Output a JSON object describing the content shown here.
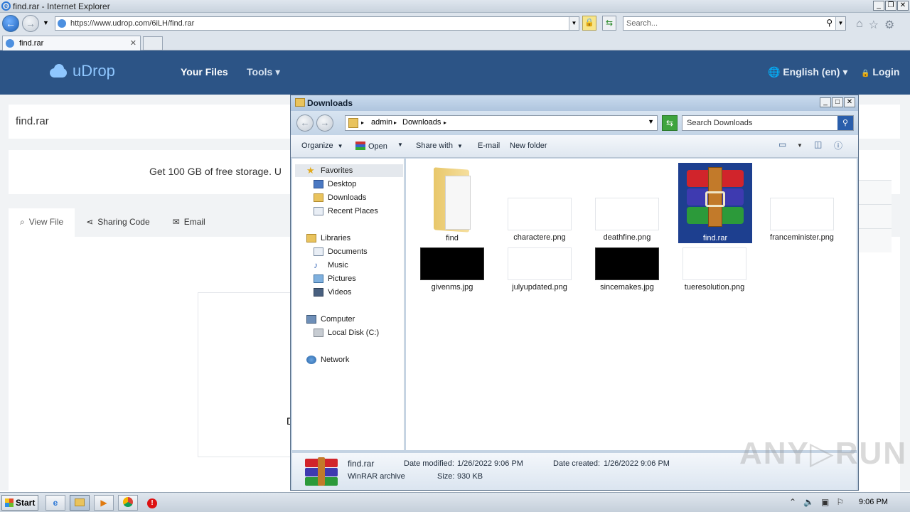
{
  "browser": {
    "window_title": "find.rar - Internet Explorer",
    "url": "https://www.udrop.com/6iLH/find.rar",
    "search_placeholder": "Search...",
    "tab_label": "find.rar",
    "tab_close": "✕"
  },
  "site": {
    "logo": "uDrop",
    "nav": {
      "your_files": "Your Files",
      "tools": "Tools ▾",
      "language": "English (en) ▾",
      "login": "Login"
    },
    "file_name": "find.rar",
    "promo": "Get 100 GB of free storage. U",
    "tabs": [
      {
        "icon": "⌕",
        "label": "View File"
      },
      {
        "icon": "⋖",
        "label": "Sharing Code"
      },
      {
        "icon": "✉",
        "label": "Email"
      }
    ],
    "fragment": "D"
  },
  "explorer": {
    "title": "Downloads",
    "breadcrumb": [
      "admin",
      "Downloads"
    ],
    "search_placeholder": "Search Downloads",
    "toolbar": {
      "organize": "Organize",
      "open": "Open",
      "share_with": "Share with",
      "email": "E-mail",
      "new_folder": "New folder"
    },
    "sidebar": {
      "favorites": "Favorites",
      "fav_items": [
        "Desktop",
        "Downloads",
        "Recent Places"
      ],
      "libraries": "Libraries",
      "lib_items": [
        "Documents",
        "Music",
        "Pictures",
        "Videos"
      ],
      "computer": "Computer",
      "computer_items": [
        "Local Disk (C:)"
      ],
      "network": "Network"
    },
    "files": [
      {
        "name": "find",
        "type": "folder"
      },
      {
        "name": "charactere.png",
        "type": "white"
      },
      {
        "name": "deathfine.png",
        "type": "white"
      },
      {
        "name": "find.rar",
        "type": "rar",
        "selected": true
      },
      {
        "name": "franceminister.png",
        "type": "white"
      },
      {
        "name": "givenms.jpg",
        "type": "black"
      },
      {
        "name": "julyupdated.png",
        "type": "white"
      },
      {
        "name": "sincemakes.jpg",
        "type": "black"
      },
      {
        "name": "tueresolution.png",
        "type": "white"
      }
    ],
    "status": {
      "name": "find.rar",
      "type": "WinRAR archive",
      "modified_label": "Date modified:",
      "modified": "1/26/2022 9:06 PM",
      "created_label": "Date created:",
      "created": "1/26/2022 9:06 PM",
      "size_label": "Size:",
      "size": "930 KB"
    }
  },
  "taskbar": {
    "start": "Start",
    "time": "9:06 PM"
  },
  "watermark": "ANY▷RUN",
  "colors": {
    "site_header": "#2c5486",
    "selection": "#1d3f8f"
  }
}
